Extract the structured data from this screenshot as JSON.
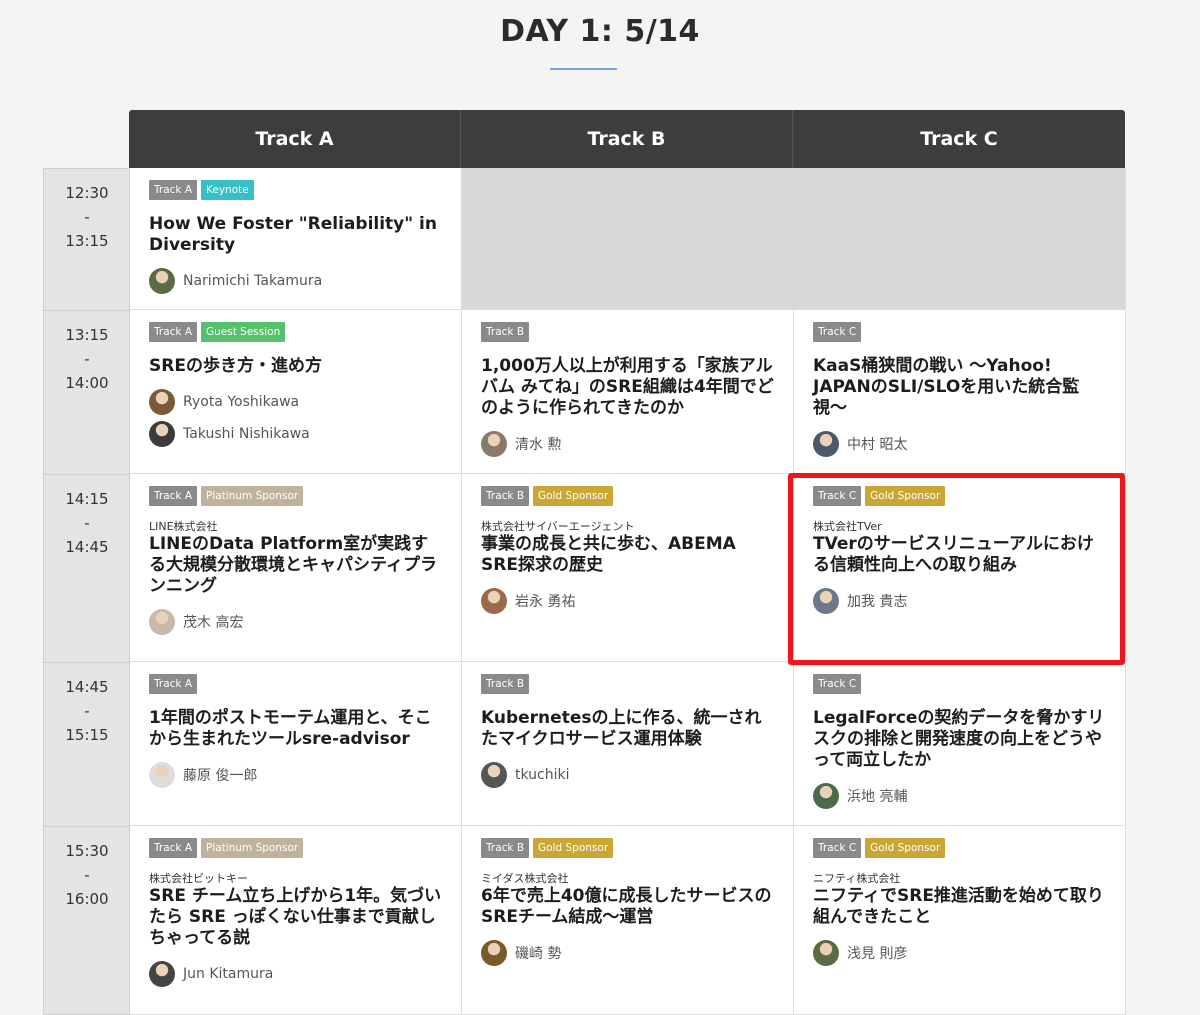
{
  "page": {
    "title": "DAY 1: 5/14"
  },
  "tracks": [
    "Track A",
    "Track B",
    "Track C"
  ],
  "times": [
    {
      "start": "12:30",
      "sep": "-",
      "end": "13:15"
    },
    {
      "start": "13:15",
      "sep": "-",
      "end": "14:00"
    },
    {
      "start": "14:15",
      "sep": "-",
      "end": "14:45"
    },
    {
      "start": "14:45",
      "sep": "-",
      "end": "15:15"
    },
    {
      "start": "15:30",
      "sep": "-",
      "end": "16:00"
    }
  ],
  "sessions": {
    "r0a": {
      "tags": [
        "Track A",
        "Keynote"
      ],
      "title": "How We Foster \"Reliability\" in Diversity",
      "speakers": [
        "Narimichi Takamura"
      ]
    },
    "r1a": {
      "tags": [
        "Track A",
        "Guest Session"
      ],
      "title": "SREの歩き方・進め方",
      "speakers": [
        "Ryota Yoshikawa",
        "Takushi Nishikawa"
      ]
    },
    "r1b": {
      "tags": [
        "Track B"
      ],
      "title": "1,000万人以上が利用する「家族アルバム みてね」のSRE組織は4年間でどのように作られてきたのか",
      "speakers": [
        "清水 勲"
      ]
    },
    "r1c": {
      "tags": [
        "Track C"
      ],
      "title": "KaaS桶狭間の戦い 〜Yahoo! JAPANのSLI/SLOを用いた統合監視〜",
      "speakers": [
        "中村 昭太"
      ]
    },
    "r2a": {
      "tags": [
        "Track A",
        "Platinum Sponsor"
      ],
      "company": "LINE株式会社",
      "title": "LINEのData Platform室が実践する大規模分散環境とキャパシティプランニング",
      "speakers": [
        "茂木 高宏"
      ]
    },
    "r2b": {
      "tags": [
        "Track B",
        "Gold Sponsor"
      ],
      "company": "株式会社サイバーエージェント",
      "title": "事業の成長と共に歩む、ABEMA SRE探求の歴史",
      "speakers": [
        "岩永 勇祐"
      ]
    },
    "r2c": {
      "tags": [
        "Track C",
        "Gold Sponsor"
      ],
      "company": "株式会社TVer",
      "title": "TVerのサービスリニューアルにおける信頼性向上への取り組み",
      "speakers": [
        "加我 貴志"
      ]
    },
    "r3a": {
      "tags": [
        "Track A"
      ],
      "title": "1年間のポストモーテム運用と、そこから生まれたツールsre-advisor",
      "speakers": [
        "藤原 俊一郎"
      ]
    },
    "r3b": {
      "tags": [
        "Track B"
      ],
      "title": "Kubernetesの上に作る、統一されたマイクロサービス運用体験",
      "speakers": [
        "tkuchiki"
      ]
    },
    "r3c": {
      "tags": [
        "Track C"
      ],
      "title": "LegalForceの契約データを脅かすリスクの排除と開発速度の向上をどうやって両立したか",
      "speakers": [
        "浜地 亮輔"
      ]
    },
    "r4a": {
      "tags": [
        "Track A",
        "Platinum Sponsor"
      ],
      "company": "株式会社ビットキー",
      "title": "SRE チーム立ち上げから1年。気づいたら SRE っぽくない仕事まで貢献しちゃってる説",
      "speakers": [
        "Jun Kitamura"
      ]
    },
    "r4b": {
      "tags": [
        "Track B",
        "Gold Sponsor"
      ],
      "company": "ミイダス株式会社",
      "title": "6年で売上40億に成長したサービスのSREチーム結成〜運営",
      "speakers": [
        "磯崎 勢"
      ]
    },
    "r4c": {
      "tags": [
        "Track C",
        "Gold Sponsor"
      ],
      "company": "ニフティ株式会社",
      "title": "ニフティでSRE推進活動を始めて取り組んできたこと",
      "speakers": [
        "浅見 則彦"
      ]
    }
  },
  "colors": {
    "track_tag": "#8a8a8a",
    "keynote": "#35c0c8",
    "guest_session": "#56c16b",
    "platinum": "#c0b39d",
    "gold": "#c9a635",
    "highlight": "#f0141e"
  }
}
